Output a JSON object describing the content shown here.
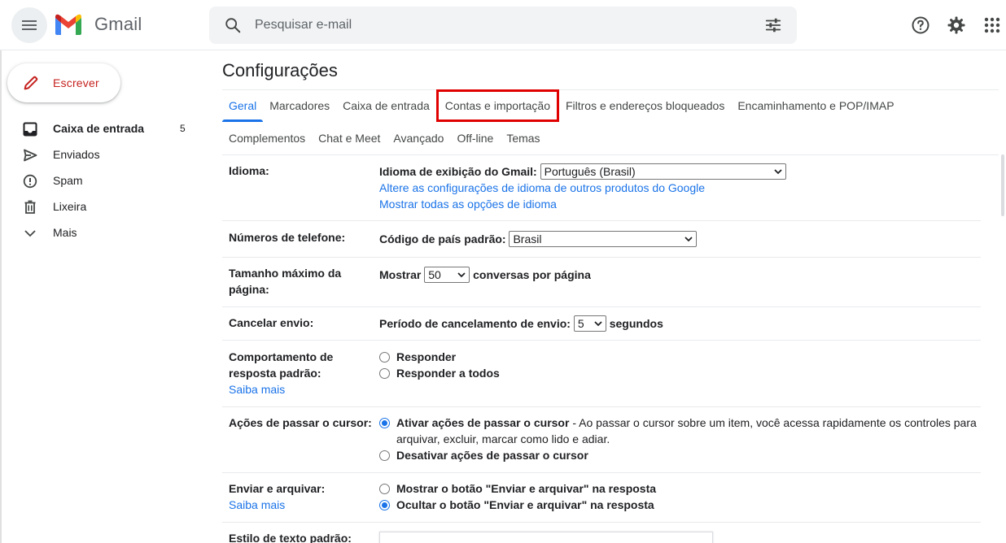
{
  "app": {
    "logo_text": "Gmail"
  },
  "search": {
    "placeholder": "Pesquisar e-mail"
  },
  "sidebar": {
    "compose_label": "Escrever",
    "items": [
      {
        "label": "Caixa de entrada",
        "count": "5",
        "icon": "inbox-icon",
        "active": true
      },
      {
        "label": "Enviados",
        "count": "",
        "icon": "send-icon",
        "active": false
      },
      {
        "label": "Spam",
        "count": "",
        "icon": "spam-icon",
        "active": false
      },
      {
        "label": "Lixeira",
        "count": "",
        "icon": "trash-icon",
        "active": false
      },
      {
        "label": "Mais",
        "count": "",
        "icon": "chevron-down-icon",
        "active": false
      }
    ]
  },
  "settings": {
    "title": "Configurações",
    "tabs_row1": [
      "Geral",
      "Marcadores",
      "Caixa de entrada",
      "Contas e importação",
      "Filtros e endereços bloqueados",
      "Encaminhamento e POP/IMAP"
    ],
    "tabs_row2": [
      "Complementos",
      "Chat e Meet",
      "Avançado",
      "Off-line",
      "Temas"
    ],
    "active_tab": "Geral",
    "highlighted_tab": "Contas e importação",
    "language": {
      "label": "Idioma:",
      "display_label": "Idioma de exibição do Gmail:",
      "display_value": "Português (Brasil)",
      "link1": "Altere as configurações de idioma de outros produtos do Google",
      "link2": "Mostrar todas as opções de idioma"
    },
    "phone": {
      "label": "Números de telefone:",
      "field_label": "Código de país padrão:",
      "value": "Brasil"
    },
    "page_size": {
      "label": "Tamanho máximo da página:",
      "prefix": "Mostrar",
      "value": "50",
      "suffix": "conversas por página"
    },
    "undo_send": {
      "label": "Cancelar envio:",
      "prefix": "Período de cancelamento de envio:",
      "value": "5",
      "suffix": "segundos"
    },
    "reply_behavior": {
      "label": "Comportamento de resposta padrão:",
      "learn_more": "Saiba mais",
      "options": [
        {
          "label": "Responder",
          "selected": false
        },
        {
          "label": "Responder a todos",
          "selected": false
        }
      ]
    },
    "hover_actions": {
      "label": "Ações de passar o cursor:",
      "option1_bold": "Ativar ações de passar o cursor",
      "option1_desc": " - Ao passar o cursor sobre um item, você acessa rapidamente os controles para arquivar, excluir, marcar como lido e adiar.",
      "option1_selected": true,
      "option2": "Desativar ações de passar o cursor",
      "option2_selected": false
    },
    "send_archive": {
      "label": "Enviar e arquivar:",
      "learn_more": "Saiba mais",
      "option1": "Mostrar o botão \"Enviar e arquivar\" na resposta",
      "option1_selected": false,
      "option2": "Ocultar o botão \"Enviar e arquivar\" na resposta",
      "option2_selected": true
    },
    "text_style": {
      "label": "Estilo de texto padrão:"
    }
  },
  "colors": {
    "accent": "#1a73e8",
    "compose_text": "#c5221f",
    "highlight_box": "#e00000"
  }
}
